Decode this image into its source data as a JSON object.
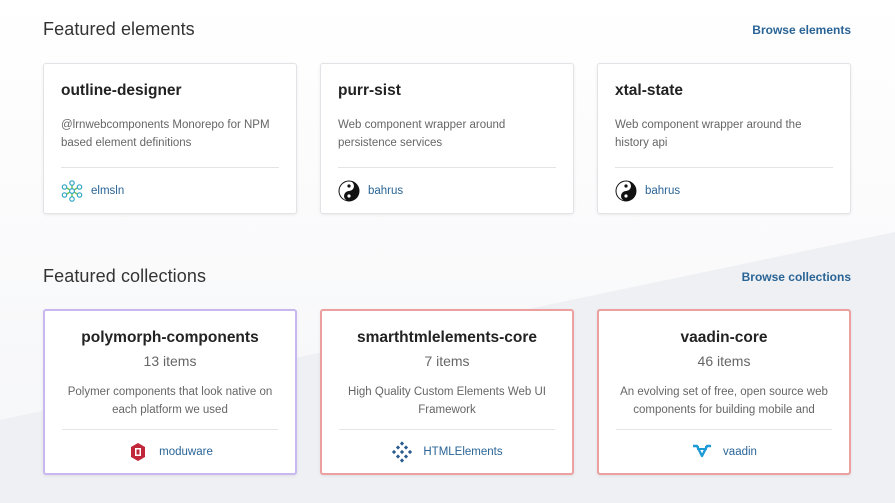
{
  "featured_elements": {
    "title": "Featured elements",
    "browse_label": "Browse elements",
    "cards": [
      {
        "name": "outline-designer",
        "description": "@lrnwebcomponents Monorepo for NPM based element definitions",
        "owner": "elmsln",
        "avatar_icon": "snowflake-icon"
      },
      {
        "name": "purr-sist",
        "description": "Web component wrapper around persistence services",
        "owner": "bahrus",
        "avatar_icon": "yin-yang-icon"
      },
      {
        "name": "xtal-state",
        "description": "Web component wrapper around the history api",
        "owner": "bahrus",
        "avatar_icon": "yin-yang-icon"
      }
    ]
  },
  "featured_collections": {
    "title": "Featured collections",
    "browse_label": "Browse collections",
    "cards": [
      {
        "name": "polymorph-components",
        "count": "13 items",
        "description": "Polymer components that look native on each platform we used",
        "owner": "moduware",
        "avatar_icon": "moduware-logo-icon",
        "border_color": "#c9b8ef"
      },
      {
        "name": "smarthtmlelements-core",
        "count": "7 items",
        "description": "High Quality Custom Elements Web UI Framework",
        "owner": "HTMLElements",
        "avatar_icon": "htmlelements-logo-icon",
        "border_color": "#eda0a0"
      },
      {
        "name": "vaadin-core",
        "count": "46 items",
        "description": "An evolving set of free, open source web components for building mobile and",
        "owner": "vaadin",
        "avatar_icon": "vaadin-logo-icon",
        "border_color": "#eda0a0"
      }
    ]
  },
  "colors": {
    "link": "#2a6496",
    "purple_border": "#c9b8ef",
    "red_border": "#eda0a0"
  }
}
